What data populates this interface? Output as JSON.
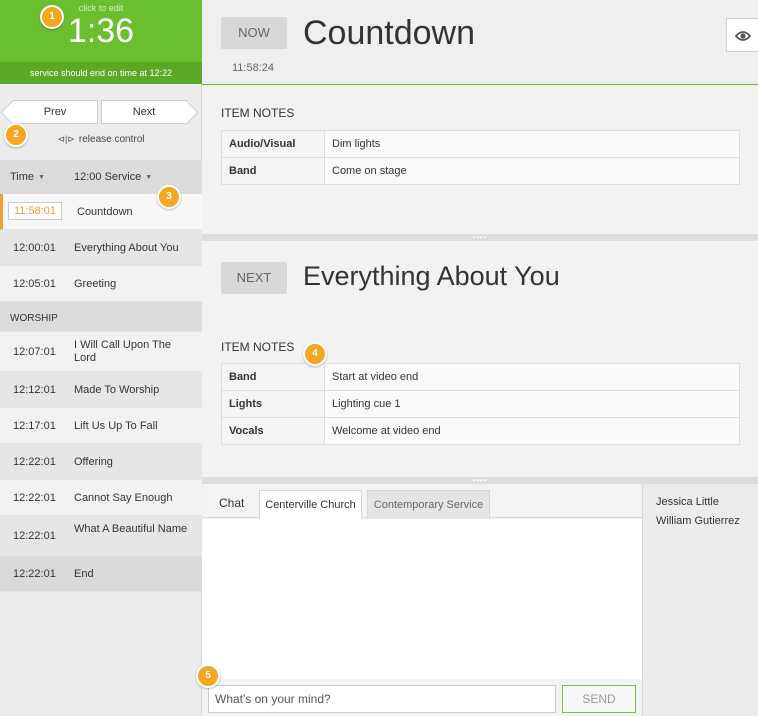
{
  "timer": {
    "hint": "click to edit",
    "time": "1:36",
    "status": "service should end on time at 12:22",
    "accent": "#6abf2e"
  },
  "controls": {
    "prev_label": "Prev",
    "next_label": "Next",
    "release_label": "release control",
    "release_icon": "release-arrows-icon"
  },
  "list": {
    "time_header": "Time",
    "service_header": "12:00 Service",
    "items": [
      {
        "time": "11:58:01",
        "name": "Countdown"
      },
      {
        "time": "12:00:01",
        "name": "Everything About You"
      },
      {
        "time": "12:05:01",
        "name": "Greeting"
      },
      {
        "section": "WORSHIP"
      },
      {
        "time": "12:07:01",
        "name": "I Will Call Upon The Lord"
      },
      {
        "time": "12:12:01",
        "name": "Made To Worship"
      },
      {
        "time": "12:17:01",
        "name": "Lift Us Up To Fall"
      },
      {
        "time": "12:22:01",
        "name": "Offering"
      },
      {
        "time": "12:22:01",
        "name": "Cannot Say Enough"
      },
      {
        "time": "12:22:01",
        "name": "What A Beautiful Name"
      },
      {
        "time": "12:22:01",
        "name": "End"
      }
    ]
  },
  "now": {
    "tag": "NOW",
    "title": "Countdown",
    "clock": "11:58:24",
    "notes_label": "ITEM NOTES",
    "notes": [
      {
        "key": "Audio/Visual",
        "value": "Dim lights"
      },
      {
        "key": "Band",
        "value": "Come on stage"
      }
    ]
  },
  "next": {
    "tag": "NEXT",
    "title": "Everything About You",
    "notes_label": "ITEM NOTES",
    "notes": [
      {
        "key": "Band",
        "value": "Start at video end"
      },
      {
        "key": "Lights",
        "value": "Lighting cue 1"
      },
      {
        "key": "Vocals",
        "value": "Welcome at video end"
      }
    ]
  },
  "chat": {
    "label": "Chat",
    "tab_active": "Centerville Church",
    "tab_inactive": "Contemporary Service",
    "placeholder": "What's on your mind?",
    "send_label": "SEND",
    "users": [
      "Jessica Little",
      "William Gutierrez"
    ]
  },
  "badges": [
    "1",
    "2",
    "3",
    "4",
    "5"
  ],
  "divider_dots": "••••",
  "eye_icon": "eye-icon"
}
